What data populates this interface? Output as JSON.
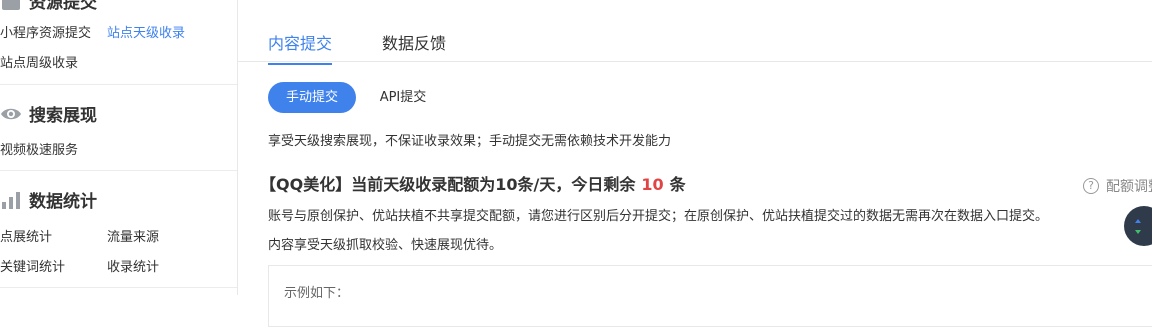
{
  "sidebar": {
    "top_section_title": "资源提交",
    "top_links": [
      {
        "label": "小程序资源提交",
        "active": false
      },
      {
        "label": "站点天级收录",
        "active": true
      },
      {
        "label": "站点周级收录",
        "active": false
      }
    ],
    "search_section": {
      "icon": "eye-icon",
      "title": "搜索展现",
      "links": [
        {
          "label": "视频极速服务"
        }
      ]
    },
    "stats_section": {
      "icon": "bar-chart-icon",
      "title": "数据统计",
      "links": [
        {
          "label": "点展统计"
        },
        {
          "label": "流量来源"
        },
        {
          "label": "关键词统计"
        },
        {
          "label": "收录统计"
        }
      ]
    }
  },
  "main": {
    "tabs": [
      {
        "label": "内容提交",
        "active": true
      },
      {
        "label": "数据反馈",
        "active": false
      }
    ],
    "sub_tabs": [
      {
        "label": "手动提交",
        "active": true
      },
      {
        "label": "API提交",
        "active": false
      }
    ],
    "description": "享受天级搜索展现，不保证收录效果；手动提交无需依赖技术开发能力",
    "quota": {
      "prefix": "【QQ美化】当前天级收录配额为10条/天，今日剩余",
      "remaining": "10",
      "suffix": "条"
    },
    "adjust_link": "配额调整",
    "notes": [
      "账号与原创保护、优站扶植不共享提交配额，请您进行区别后分开提交；在原创保护、优站扶植提交过的数据无需再次在数据入口提交。",
      "内容享受天级抓取校验、快速展现优待。"
    ],
    "example_label": "示例如下："
  },
  "colors": {
    "accent": "#3f82ec",
    "highlight": "#e04444"
  }
}
